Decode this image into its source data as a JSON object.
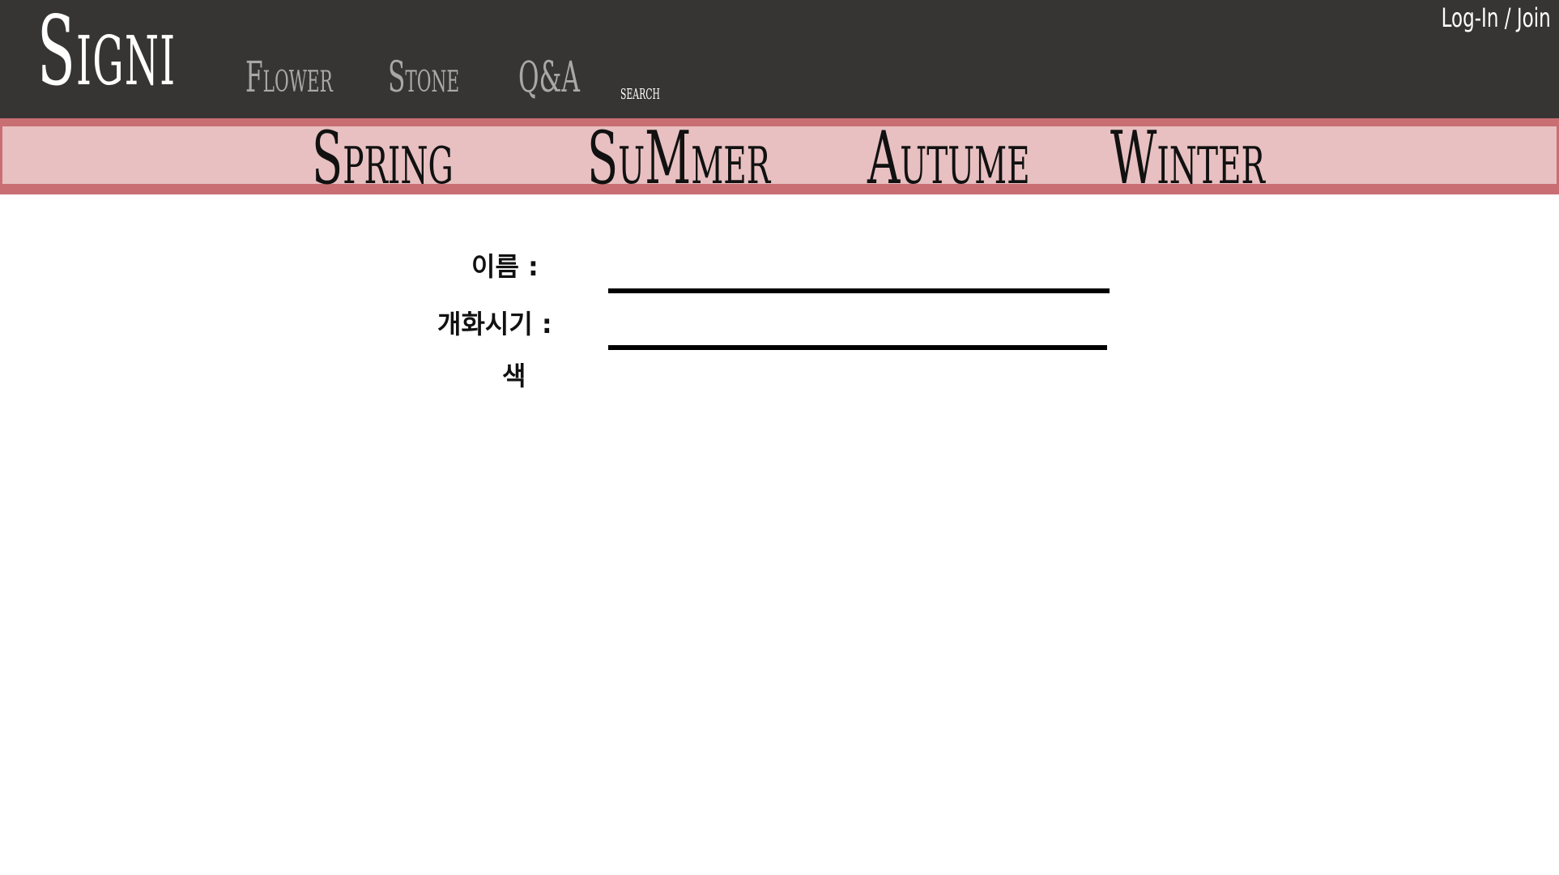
{
  "header": {
    "logo": "Signi",
    "nav": {
      "flower": "Flower",
      "stone": "Stone",
      "qa": "Q&A",
      "search": "search"
    },
    "auth": "Log-In / Join"
  },
  "seasons": {
    "spring": "Spring",
    "summer": "SuMmer",
    "autumn": "Autume",
    "winter": "Winter"
  },
  "form": {
    "name_label": "이름 :",
    "name_value": "",
    "bloom_label": "개화시기 :",
    "bloom_value": "",
    "color_label": "색"
  },
  "colors": {
    "header_bg": "#363534",
    "season_border": "#c96f74",
    "season_bg": "#e8c0c1",
    "nav_text": "#a8a8a8"
  }
}
